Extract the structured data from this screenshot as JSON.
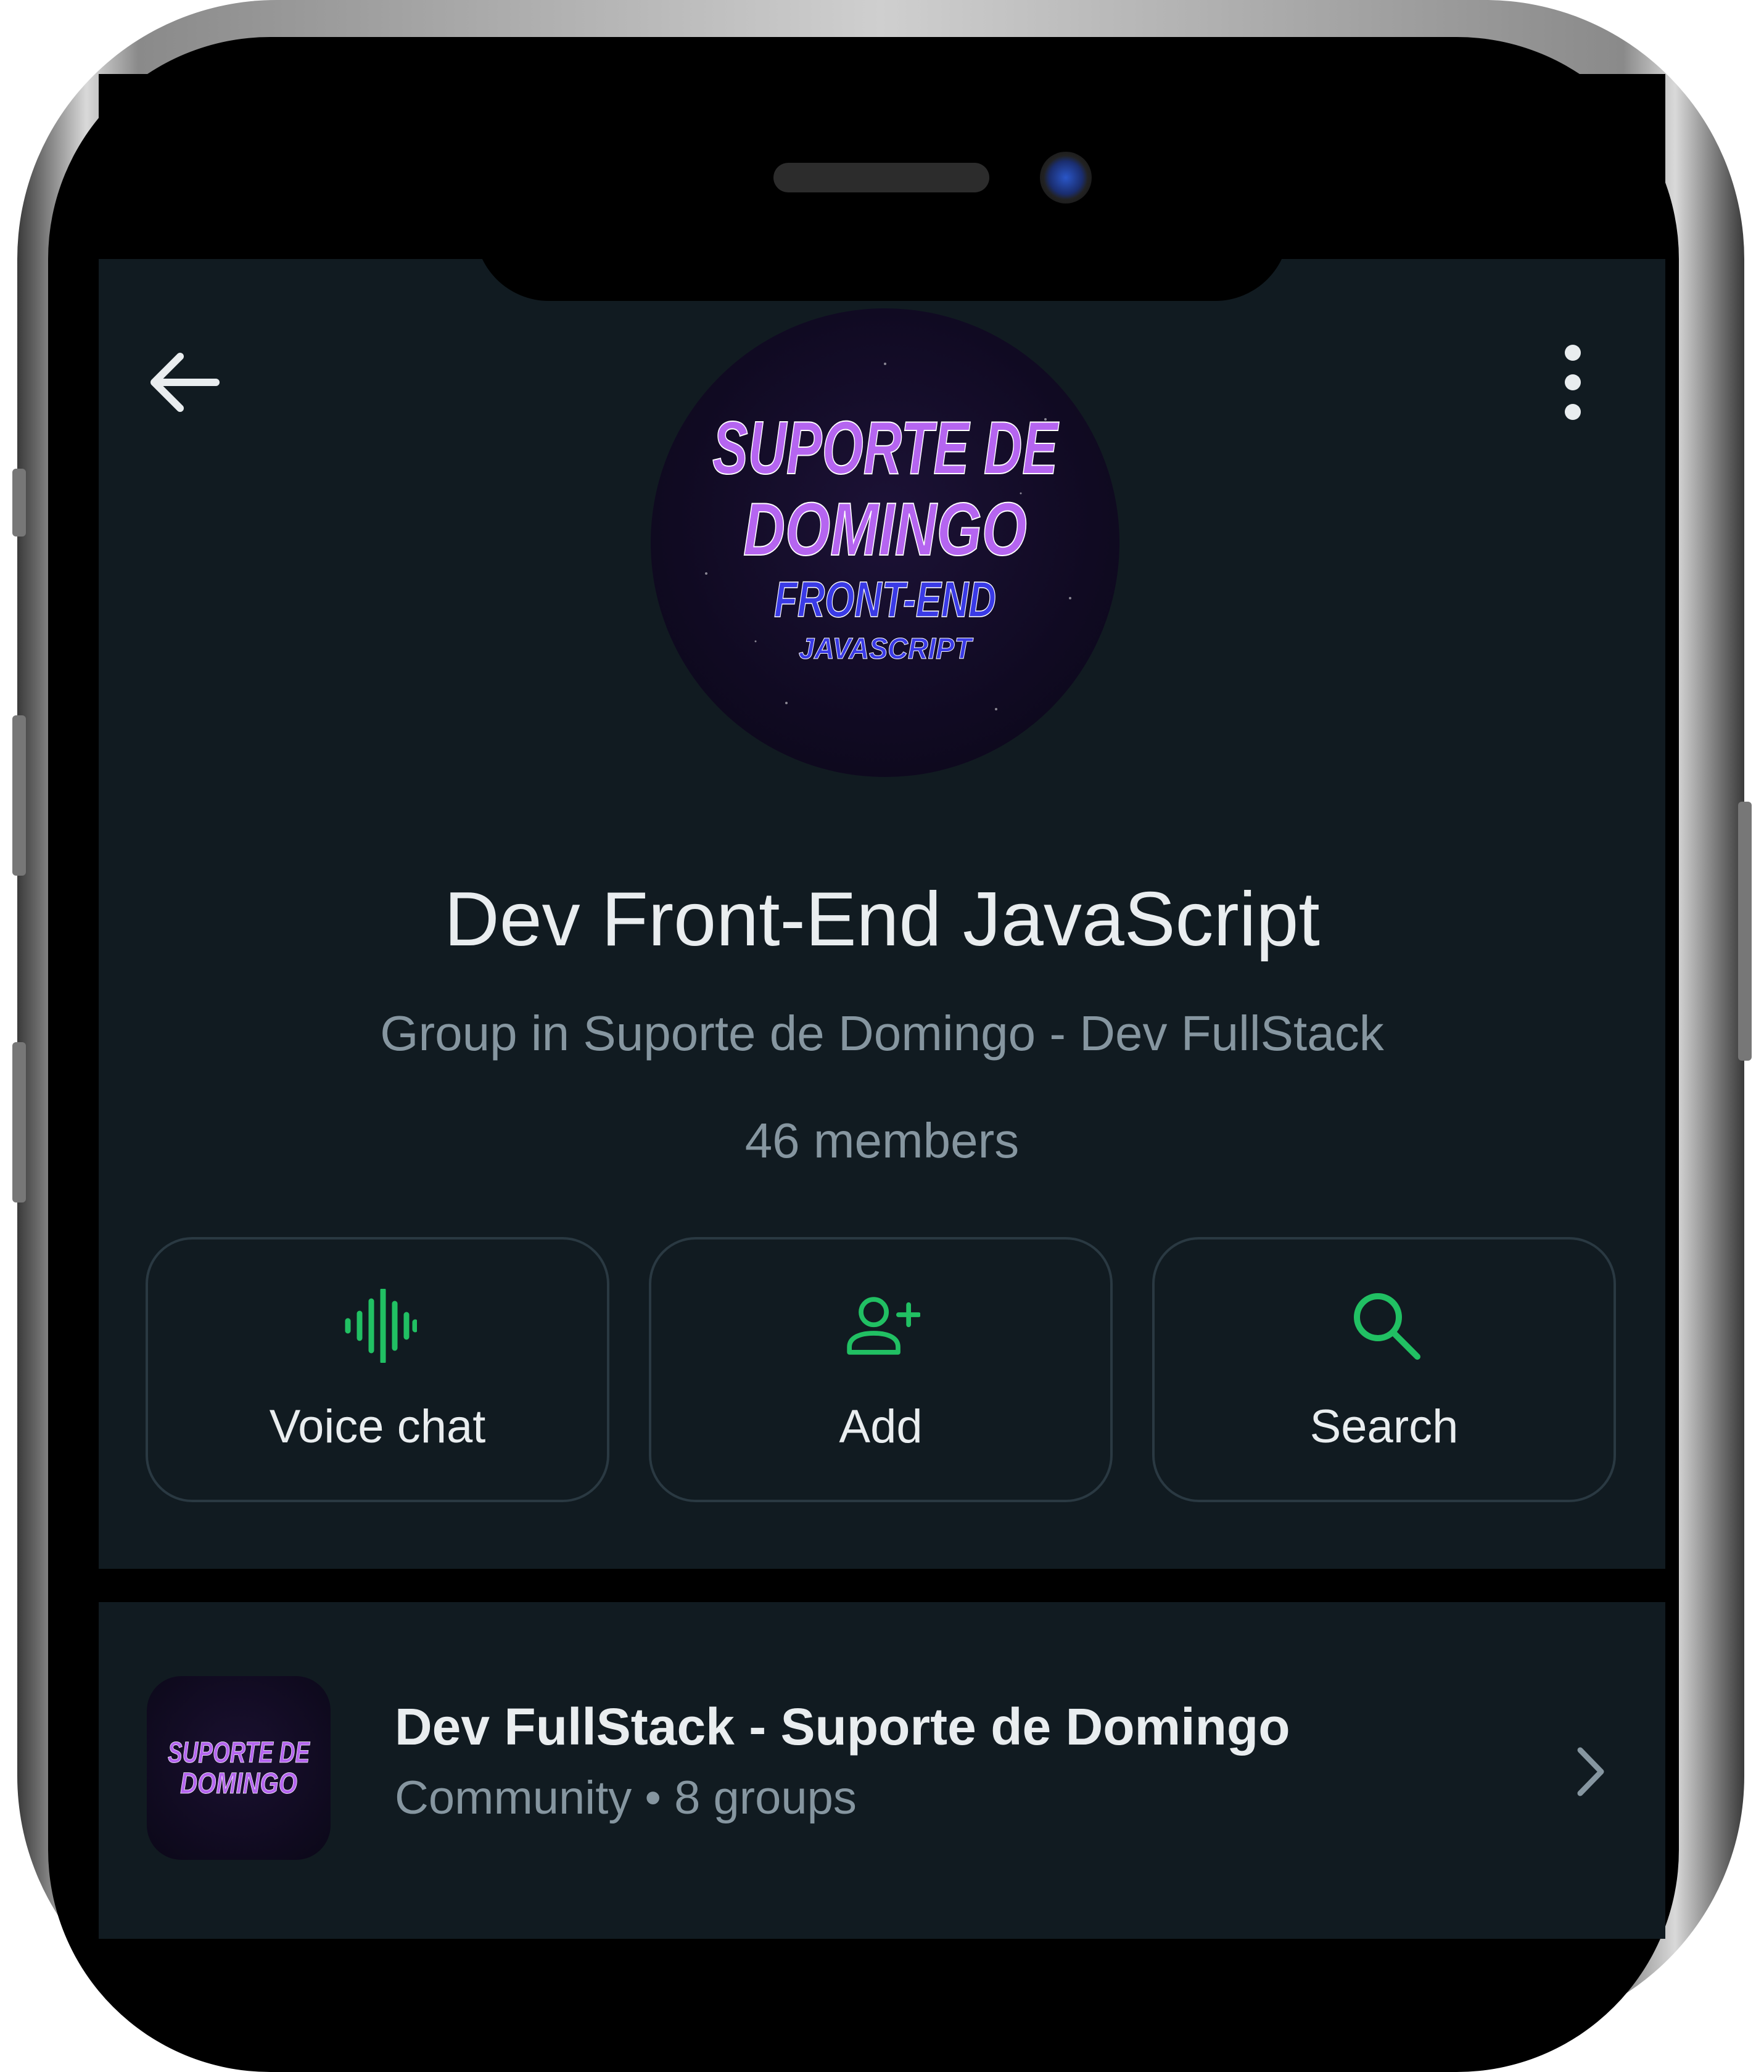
{
  "header": {
    "back_icon": "arrow-left-icon",
    "menu_icon": "more-vertical-icon"
  },
  "group": {
    "avatar_lines": [
      "SUPORTE DE",
      "DOMINGO",
      "FRONT-END",
      "JAVASCRIPT"
    ],
    "title": "Dev Front-End JavaScript",
    "subtitle": "Group in Suporte de Domingo - Dev FullStack",
    "members": "46 members"
  },
  "actions": [
    {
      "label": "Voice chat",
      "icon": "voice-wave-icon"
    },
    {
      "label": "Add",
      "icon": "add-person-icon"
    },
    {
      "label": "Search",
      "icon": "search-icon"
    }
  ],
  "community": {
    "avatar_lines": [
      "SUPORTE DE",
      "DOMINGO"
    ],
    "name": "Dev FullStack - Suporte de Domingo",
    "meta": "Community • 8 groups",
    "chevron_icon": "chevron-right-icon"
  },
  "colors": {
    "background": "#111b21",
    "accent_green": "#21c063",
    "title_text": "#e9edef",
    "secondary_text": "#8696a0",
    "avatar_purple": "#b565f0",
    "avatar_blue": "#3a3ae6"
  }
}
